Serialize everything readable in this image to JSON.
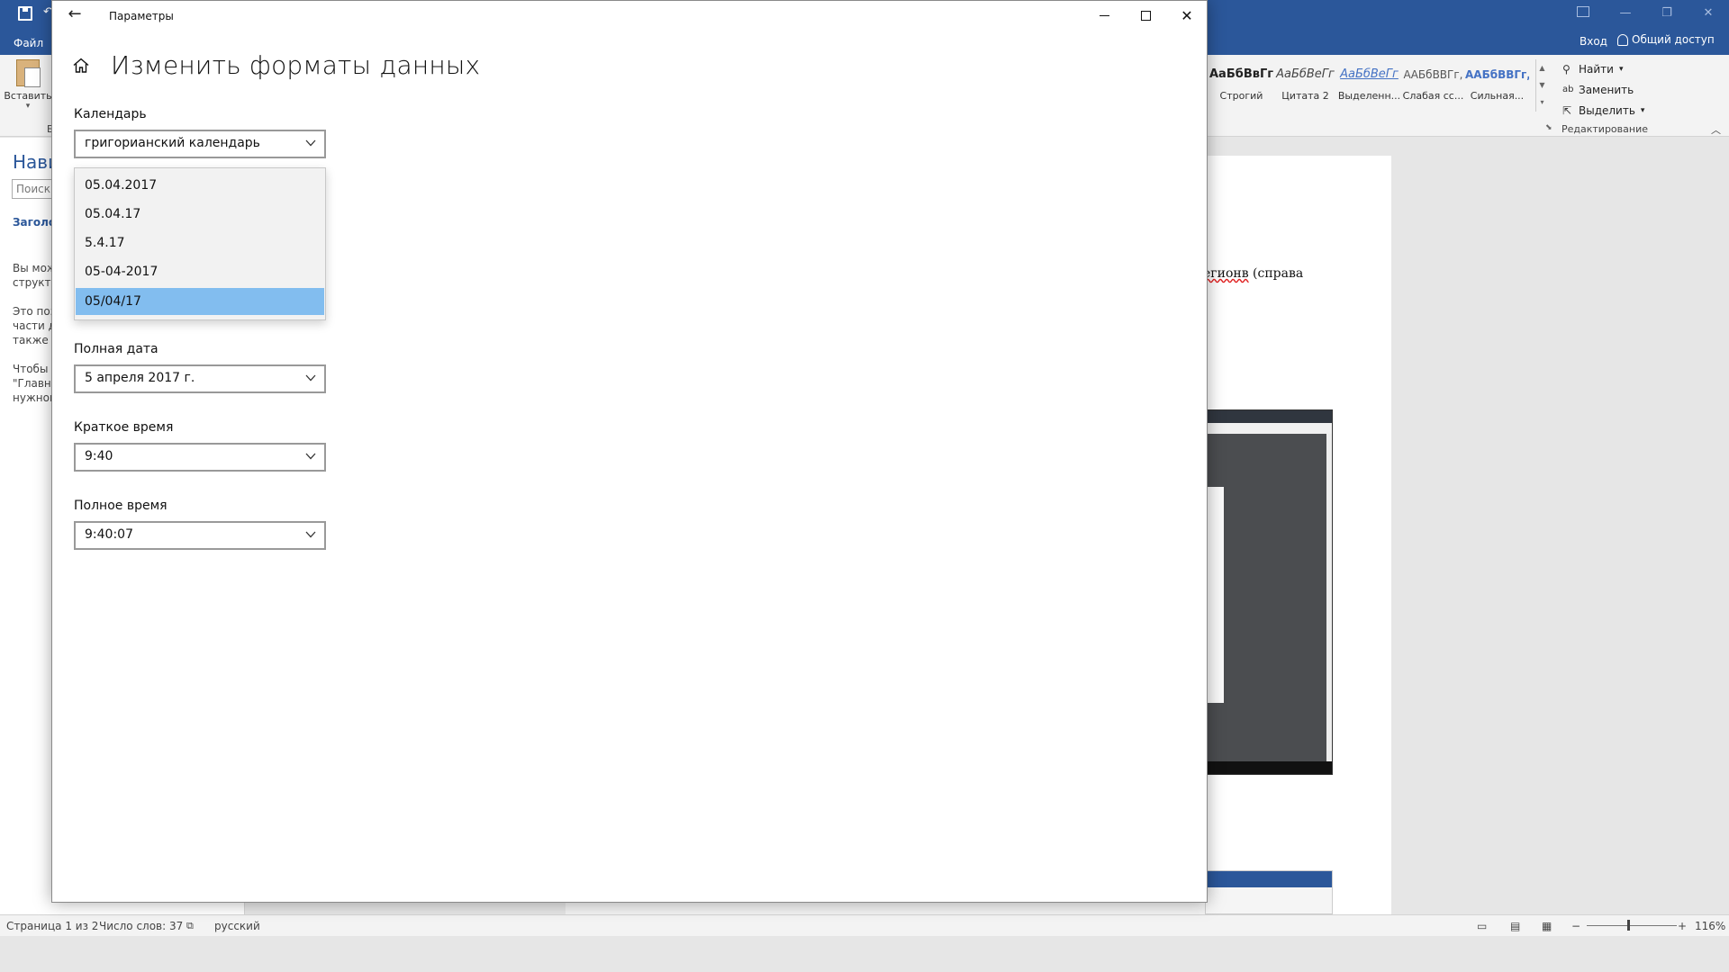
{
  "word": {
    "file_tab": "Файл",
    "sign_in": "Вход",
    "share": "Общий доступ",
    "paste_label": "Вставить",
    "paste_extra": "Б",
    "styles": [
      {
        "sample": "АаБбВвГг,",
        "name": "Строгий"
      },
      {
        "sample": "АаБбВеГг",
        "name": "Цитата 2"
      },
      {
        "sample": "АаБбВеГг",
        "name": "Выделенн..."
      },
      {
        "sample": "ААБбВВГг,",
        "name": "Слабая сс..."
      },
      {
        "sample": "ААБбВВГг,",
        "name": "Сильная..."
      }
    ],
    "editing": {
      "find": "Найти",
      "replace": "Заменить",
      "select": "Выделить",
      "group_label": "Редактирование"
    },
    "nav_pane": {
      "title": "Нави",
      "search_placeholder": "Поиск в",
      "tab_headings": "Заголов",
      "para1": [
        "Вы мож",
        "структу"
      ],
      "para2": [
        "Это поз",
        "части д",
        "также б"
      ],
      "para3": [
        "Чтобы з",
        "\"Главна",
        "нужном"
      ]
    },
    "doc_fragment_plain": "егионв",
    "doc_fragment_rest": " (справа",
    "statusbar": {
      "page": "Страница 1 из 2",
      "words": "Число слов: 37",
      "language": "русский",
      "zoom": "116%"
    }
  },
  "settings": {
    "window_title": "Параметры",
    "page_title": "Изменить форматы данных",
    "calendar": {
      "label": "Календарь",
      "value": "григорианский календарь"
    },
    "short_date_options": [
      {
        "label": "05.04.2017",
        "selected": false
      },
      {
        "label": "05.04.17",
        "selected": false
      },
      {
        "label": "5.4.17",
        "selected": false
      },
      {
        "label": "05-04-2017",
        "selected": false
      },
      {
        "label": "05/04/17",
        "selected": true
      }
    ],
    "long_date": {
      "label": "Полная дата",
      "value": "5 апреля 2017 г."
    },
    "short_time": {
      "label": "Краткое время",
      "value": "9:40"
    },
    "long_time": {
      "label": "Полное время",
      "value": "9:40:07"
    }
  },
  "colors": {
    "word_blue": "#2b579a",
    "selection_blue": "#82bdef",
    "taskbar": "#101010"
  }
}
